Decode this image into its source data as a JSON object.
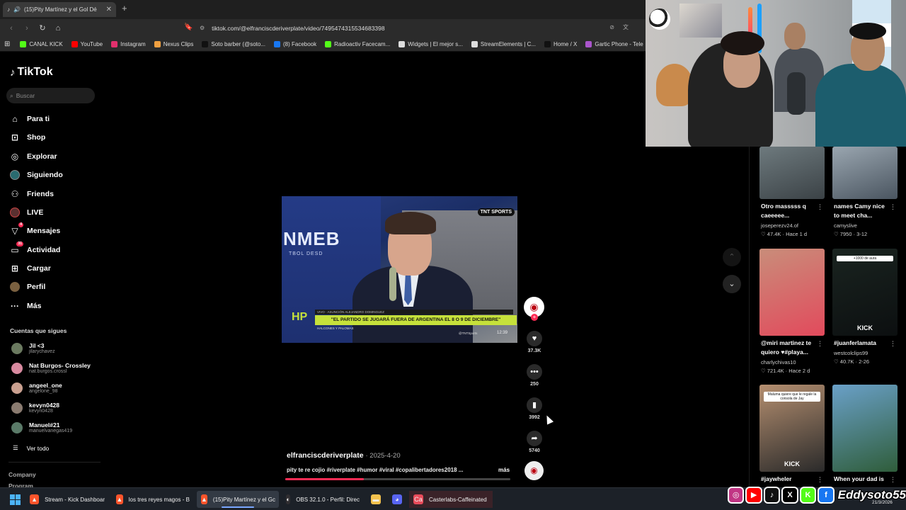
{
  "browser": {
    "tab": {
      "title": "(15)Pity Martínez y el Gol Dé",
      "icon": "tiktok-icon"
    },
    "url": "tiktok.com/@elfranciscderiverplate/video/7495474315534683398",
    "bookmarks": [
      {
        "label": "CANAL KICK",
        "color": "#53fc18"
      },
      {
        "label": "YouTube",
        "color": "#ff0000"
      },
      {
        "label": "Instagram",
        "color": "#e1306c"
      },
      {
        "label": "Nexus Clips",
        "color": "#f0a040"
      },
      {
        "label": "Soto barber (@soto...",
        "color": "#111111"
      },
      {
        "label": "(8) Facebook",
        "color": "#1877f2"
      },
      {
        "label": "Radioactiv Facecam...",
        "color": "#53fc18"
      },
      {
        "label": "Widgets | El mejor s...",
        "color": "#dddddd"
      },
      {
        "label": "StreamElements | C...",
        "color": "#dddddd"
      },
      {
        "label": "Home / X",
        "color": "#111111"
      },
      {
        "label": "Gartic Phone - Tele",
        "color": "#aa55cc"
      }
    ]
  },
  "sidebar": {
    "logo": "TikTok",
    "search_placeholder": "Buscar",
    "nav": [
      {
        "label": "Para ti",
        "icon": "home-icon"
      },
      {
        "label": "Shop",
        "icon": "shopping-bag-icon"
      },
      {
        "label": "Explorar",
        "icon": "compass-icon"
      },
      {
        "label": "Siguiendo",
        "icon": "following-avatar-icon"
      },
      {
        "label": "Friends",
        "icon": "friends-icon"
      },
      {
        "label": "LIVE",
        "icon": "live-icon"
      },
      {
        "label": "Mensajes",
        "icon": "message-icon",
        "badge": "4"
      },
      {
        "label": "Actividad",
        "icon": "activity-icon",
        "badge": "31"
      },
      {
        "label": "Cargar",
        "icon": "upload-icon"
      },
      {
        "label": "Perfil",
        "icon": "profile-avatar-icon"
      },
      {
        "label": "Más",
        "icon": "more-icon"
      }
    ],
    "following_title": "Cuentas que sigues",
    "following": [
      {
        "name": "Jil <3",
        "handle": "jilarychavez",
        "color": "#6b7a60"
      },
      {
        "name": "Nat Burgos- Crossley",
        "handle": "nat.burgos.crossl",
        "color": "#d98aa0"
      },
      {
        "name": "angeel_one",
        "handle": "angelone_98",
        "color": "#caa090"
      },
      {
        "name": "kevyn0428",
        "handle": "kevyn0428",
        "color": "#8a7b70"
      },
      {
        "name": "Manuel#21",
        "handle": "manuelvanegas419",
        "color": "#5a7a68"
      }
    ],
    "see_all": "Ver todo",
    "footer": [
      "Company",
      "Program"
    ]
  },
  "video": {
    "overlay_logo": "TNT SPORTS",
    "backdrop_text": "NMEB",
    "backdrop_sub": "TBOL DESD",
    "lower_top": "VIVO · ASUNCIÓN    ALEJANDRO DOMINGUEZ",
    "headline": "\"EL PARTIDO SE JUGARÁ FUERA DE ARGENTINA EL 8 O 9 DE DICIEMBRE\"",
    "lower_sub": "HALCONES Y PALOMAS",
    "lower_account": "@TNTSports",
    "lower_time": "12:39",
    "corner_logo": "HP"
  },
  "actions": {
    "likes": "37.3K",
    "comments": "250",
    "saves": "3992",
    "shares": "5740"
  },
  "caption": {
    "user": "elfranciscderiverplate",
    "date": "· 2025-4-20",
    "text": "pity te re cojio #riverplate #humor #viral #copalibertadores2018 ...",
    "more": "más",
    "progress": 0.35
  },
  "recommendations": [
    {
      "title": "Otro masssss q",
      "title2": "caeeeee...",
      "author": "joseperezv24.of",
      "stats": "♡ 47.4K · Hace 1 d",
      "color1": "#6e7a7e",
      "color2": "#3b4246"
    },
    {
      "title": "names Camy nice",
      "title2": "to meet cha...",
      "author": "camyslive",
      "stats": "♡ 7950 · 3-12",
      "color1": "#9aa6b0",
      "color2": "#4a5560"
    },
    {
      "title": "@miri martinez te",
      "title2": "quiero ♥#playa...",
      "author": "charlychivas10",
      "stats": "♡ 721.4K · Hace 2 d",
      "color1": "#c98d7a",
      "color2": "#e24a5c"
    },
    {
      "title": "#juanferlamata",
      "title2": "",
      "author": "westcolclips99",
      "stats": "♡ 40.7K · 2-26",
      "color1": "#1a2420",
      "color2": "#0c0f10",
      "tag": "+1000 de aura",
      "kick": "KICK"
    },
    {
      "title": "#jaywheler",
      "title2": "",
      "author": "",
      "stats": "",
      "color1": "#b58f70",
      "color2": "#2a2a2a",
      "tag": "Maluma quiere que le regale la consola de Jay",
      "kick": "KICK"
    },
    {
      "title": "When your dad is",
      "title2": "",
      "author": "",
      "stats": "",
      "color1": "#6aa0c8",
      "color2": "#2f5d3a"
    }
  ],
  "taskbar": [
    {
      "label": "Stream - Kick Dashboar",
      "icon": "brave-icon",
      "color": "#fb542b"
    },
    {
      "label": "los tres reyes magos - B",
      "icon": "brave-icon",
      "color": "#fb542b"
    },
    {
      "label": "(15)Pity Martínez y el Gc",
      "icon": "brave-icon",
      "color": "#fb542b"
    },
    {
      "label": "OBS 32.1.0 - Perfil: Direc",
      "icon": "obs-icon",
      "color": "#302e31"
    },
    {
      "label": "",
      "icon": "folder-icon",
      "color": "#f2c14e"
    },
    {
      "label": "",
      "icon": "discord-icon",
      "color": "#5865f2"
    },
    {
      "label": "Casterlabs-Caffeinated",
      "icon": "casterlabs-icon",
      "color": "#e94b5a"
    }
  ],
  "overlay": {
    "handle": "Eddysoto55",
    "date": "21/3/2026",
    "socials": [
      {
        "name": "instagram-icon",
        "glyph": "◎",
        "color": "#c13584"
      },
      {
        "name": "youtube-icon",
        "glyph": "▶",
        "color": "#ff0000"
      },
      {
        "name": "tiktok-icon",
        "glyph": "♪",
        "color": "#111111"
      },
      {
        "name": "x-icon",
        "glyph": "X",
        "color": "#000000"
      },
      {
        "name": "kick-icon",
        "glyph": "K",
        "color": "#53fc18"
      },
      {
        "name": "facebook-icon",
        "glyph": "f",
        "color": "#1877f2"
      }
    ]
  }
}
